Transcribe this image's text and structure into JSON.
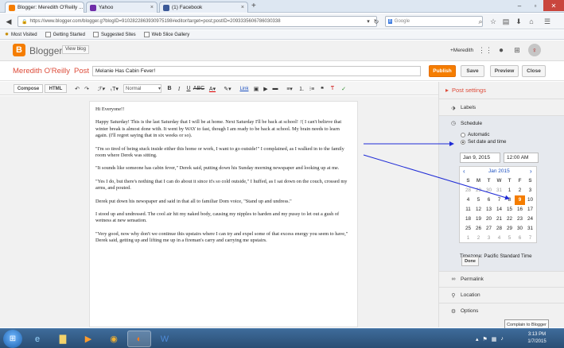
{
  "browser": {
    "tabs": [
      {
        "label": "Blogger: Meredith O'Reilly ...",
        "favicon_color": "#f57d00",
        "active": true
      },
      {
        "label": "Yahoo",
        "favicon_color": "#6f2da8",
        "active": false
      },
      {
        "label": "(1) Facebook",
        "favicon_color": "#3b5998",
        "active": false
      }
    ],
    "new_tab": "+",
    "url": "https://www.blogger.com/blogger.g?blogID=9102822863930975198#editor/target=post;postID=2093335606786030338",
    "search_placeholder": "Google",
    "bookmarks": [
      "Most Visited",
      "Getting Started",
      "Suggested Sites",
      "Web Slice Gallery"
    ]
  },
  "blogger": {
    "brand": "Blogger",
    "view_blog": "View blog",
    "user": "+Meredith",
    "author": "Meredith O'Reilly",
    "separator": "·",
    "section": "Post",
    "post_title": "Melanie Has Cabin Fever!",
    "actions": {
      "publish": "Publish",
      "save": "Save",
      "preview": "Preview",
      "close": "Close"
    }
  },
  "toolbar": {
    "compose": "Compose",
    "html": "HTML",
    "font": "Normal",
    "link": "Link"
  },
  "editor": {
    "paragraphs": [
      "Hi Everyone!!",
      "Happy Saturday! This is the last Saturday that I will be at home. Next Saturday I'll be back at school! :'( I can't believe that winter break is almost done with. It went by WAY to fast, though I am ready to be back at school. My brain needs to learn again. (I'll regret saying that in six weeks or so).",
      "\"I'm so tired of being stuck inside either this home or work, I want to go outside!\" I complained, as I walked in to the family room where Derek was sitting.",
      "\"It sounds like someone has cabin fever,\" Derek said, putting down his Sunday morning newspaper and looking up at me.",
      "\"Yes I do, but there's nothing that I can do about it since it's so cold outside,\" I huffed, as I sat down on the couch, crossed my arms, and pouted.",
      "Derek put down his newspaper and said in that all to familiar Dom voice, \"Stand up and undress.\"",
      "I stood up and undressed. The cool air hit my naked body, causing my nipples to harden and my pussy to let out a gush of wetness at new sensation.",
      "\"Very good, now why don't we continue this upstairs where I can try and expel some of that excess energy you seem to have,\" Derek said, getting up and lifting me up in a fireman's carry and carrying me upstairs."
    ]
  },
  "settings": {
    "title": "Post settings",
    "labels": "Labels",
    "schedule": "Schedule",
    "automatic": "Automatic",
    "set_date": "Set date and time",
    "date_value": "Jan 9, 2015",
    "time_value": "12:00 AM",
    "month": "Jan 2015",
    "prev": "‹",
    "next": "›",
    "weekdays": [
      "S",
      "M",
      "T",
      "W",
      "T",
      "F",
      "S"
    ],
    "weeks": [
      [
        "28",
        "29",
        "30",
        "31",
        "1",
        "2",
        "3"
      ],
      [
        "4",
        "5",
        "6",
        "7",
        "8",
        "9",
        "10"
      ],
      [
        "11",
        "12",
        "13",
        "14",
        "15",
        "16",
        "17"
      ],
      [
        "18",
        "19",
        "20",
        "21",
        "22",
        "23",
        "24"
      ],
      [
        "25",
        "26",
        "27",
        "28",
        "29",
        "30",
        "31"
      ],
      [
        "1",
        "2",
        "3",
        "4",
        "5",
        "6",
        "7"
      ]
    ],
    "selected_day": "9",
    "timezone": "Timezone: Pacific Standard Time",
    "done": "Done",
    "permalink": "Permalink",
    "location": "Location",
    "options": "Options"
  },
  "complain": "Complain to Blogger",
  "taskbar": {
    "time": "3:13 PM",
    "date": "1/7/2015"
  },
  "colors": {
    "accent": "#f57d00",
    "red_text": "#dd4b39",
    "arrow": "#1f2bd6"
  }
}
